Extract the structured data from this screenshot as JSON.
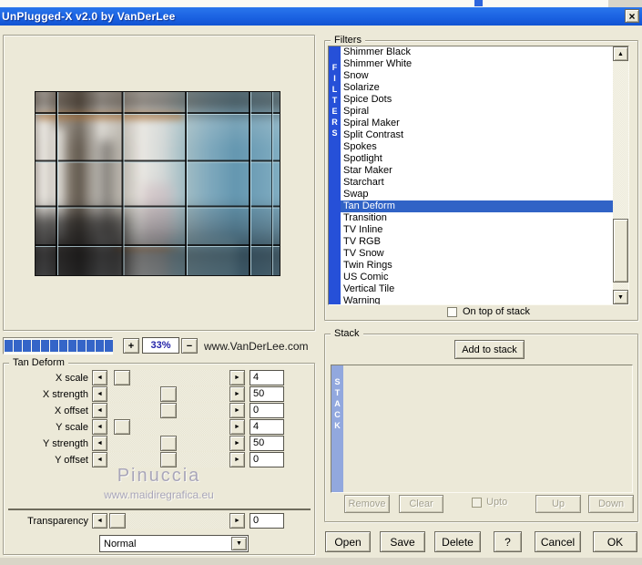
{
  "window": {
    "title": "UnPlugged-X v2.0 by VanDerLee",
    "close_label": "×"
  },
  "icons": {
    "dropdown_arrow": "▼",
    "scroll_up": "▲",
    "scroll_down": "▼",
    "slider_left": "◄",
    "slider_right": "►"
  },
  "zoom_controls": {
    "plus": "+",
    "minus": "−",
    "level": "33%",
    "website": "www.VanDerLee.com",
    "progress_segments": 12
  },
  "filters": {
    "group_label": "Filters",
    "strip_letters": [
      "F",
      "I",
      "L",
      "T",
      "E",
      "R",
      "S"
    ],
    "items": [
      "Shimmer Black",
      "Shimmer White",
      "Snow",
      "Solarize",
      "Spice Dots",
      "Spiral",
      "Spiral Maker",
      "Split Contrast",
      "Spokes",
      "Spotlight",
      "Star Maker",
      "Starchart",
      "Swap",
      "Tan Deform",
      "Transition",
      "TV Inline",
      "TV RGB",
      "TV Snow",
      "Twin Rings",
      "US Comic",
      "Vertical Tile",
      "Warning"
    ],
    "selected": "Tan Deform",
    "on_top_checkbox": "On top of stack",
    "on_top_checked": false
  },
  "params": {
    "group_label": "Tan Deform",
    "sliders": [
      {
        "label": "X scale",
        "value": "4",
        "thumb_pct": 6
      },
      {
        "label": "X strength",
        "value": "50",
        "thumb_pct": 50
      },
      {
        "label": "X offset",
        "value": "0",
        "thumb_pct": 50
      },
      {
        "label": "Y scale",
        "value": "4",
        "thumb_pct": 6
      },
      {
        "label": "Y strength",
        "value": "50",
        "thumb_pct": 50
      },
      {
        "label": "Y offset",
        "value": "0",
        "thumb_pct": 50
      }
    ],
    "transparency": {
      "label": "Transparency",
      "value": "0",
      "thumb_pct": 2
    },
    "blend_mode": "Normal"
  },
  "watermark": {
    "name": "Pinuccia",
    "site": "www.maidiregrafica.eu"
  },
  "stack": {
    "group_label": "Stack",
    "add_button": "Add to stack",
    "strip_letters": [
      "S",
      "T",
      "A",
      "C",
      "K"
    ],
    "remove": "Remove",
    "clear": "Clear",
    "upto": "Upto",
    "up": "Up",
    "down": "Down",
    "upto_checked": false
  },
  "actions": {
    "open": "Open",
    "save": "Save",
    "delete": "Delete",
    "help": "?",
    "cancel": "Cancel",
    "ok": "OK"
  },
  "colors": {
    "dialog_bg": "#ece9d8",
    "titlebar_top": "#2a76ec",
    "titlebar_bottom": "#1153d2",
    "filters_strip": "#2650d8",
    "selection": "#3163c6",
    "stack_strip": "#92a8de",
    "progress_block": "#3465c8",
    "watermark": "#a9a6ba",
    "zoom_text": "#2222a8"
  }
}
